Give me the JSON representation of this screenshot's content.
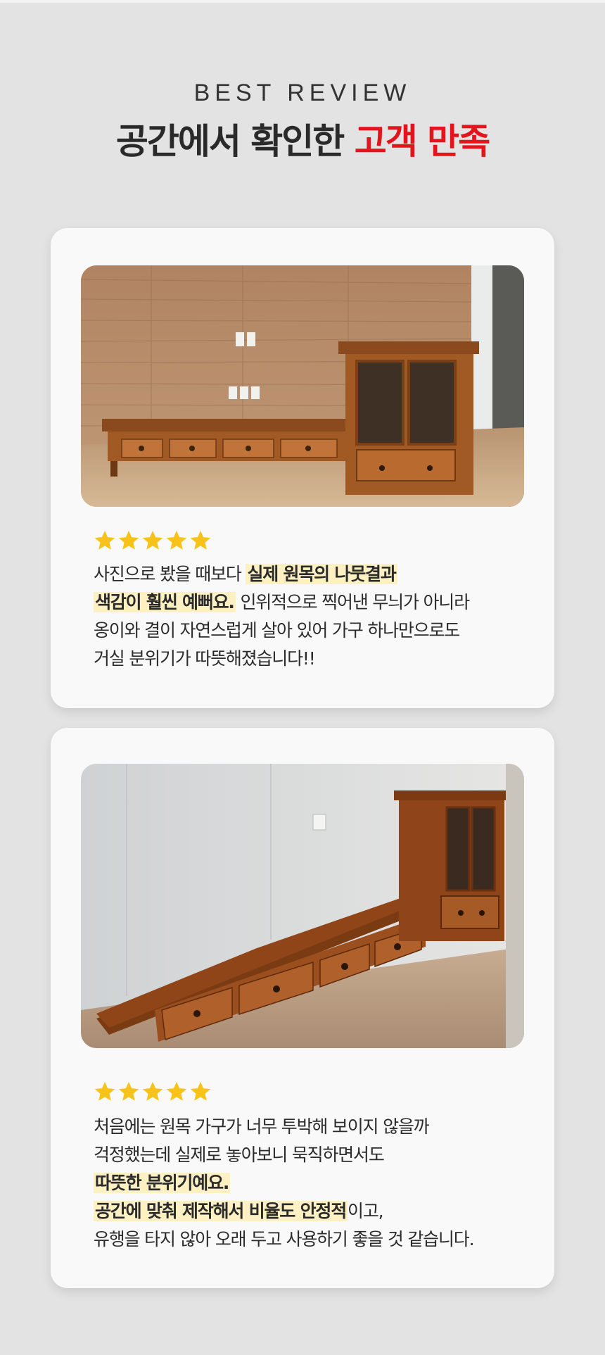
{
  "header": {
    "eyebrow": "BEST REVIEW",
    "title_main": "공간에서 확인한 ",
    "title_accent": "고객 만족"
  },
  "colors": {
    "accent": "#e3141c",
    "star": "#f7c31a",
    "highlight": "#fdf1c4",
    "background": "#e3e3e3",
    "card": "#f9f9f9"
  },
  "reviews": [
    {
      "rating": 5,
      "photo": "living-room-wooden-tv-cabinet-with-glass-door-cabinet",
      "lines": [
        {
          "text": "사진으로 봤을 때보다 ",
          "highlight": "실제 원목의 나뭇결과"
        },
        {
          "highlight": "색감이 훨씬 예뻐요.",
          "text": " 인위적으로 찍어낸 무늬가 아니라"
        },
        {
          "text": "옹이와 결이 자연스럽게 살아 있어 가구 하나만으로도"
        },
        {
          "text": "거실 분위기가 따뜻해졌습니다!!"
        }
      ]
    },
    {
      "rating": 5,
      "photo": "long-wooden-drawer-cabinet-with-tall-glass-cabinet",
      "lines": [
        {
          "text": "처음에는 원목 가구가 너무 투박해 보이지 않을까"
        },
        {
          "text": "걱정했는데 실제로 놓아보니 묵직하면서도"
        },
        {
          "highlight": "따뜻한 분위기예요."
        },
        {
          "highlight": "공간에 맞춰 제작해서 비율도 안정적",
          "text": "이고,"
        },
        {
          "text": "유행을 타지 않아 오래 두고 사용하기 좋을 것 같습니다."
        }
      ]
    }
  ]
}
